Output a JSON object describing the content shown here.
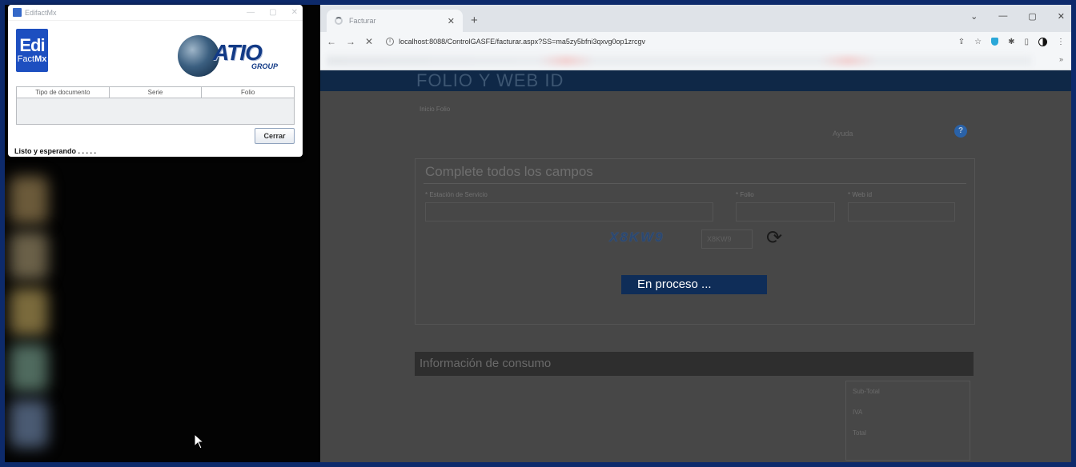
{
  "edi": {
    "title": "EdifactMx",
    "logo_top": "Edi",
    "logo_fact": "Fact",
    "logo_mx": "Mx",
    "atio_text": "ATIO",
    "atio_group": "GROUP",
    "columns": [
      "Tipo de documento",
      "Serie",
      "Folio"
    ],
    "close_button": "Cerrar",
    "status": "Listo y esperando . . . . ."
  },
  "browser": {
    "tab_title": "Facturar",
    "url": "localhost:8088/ControlGASFE/facturar.aspx?SS=ma5zy5bfni3qxvg0op1zrcgv",
    "more": "»"
  },
  "page": {
    "header": "FOLIO Y WEB ID",
    "crumbs": "Inicio    Folio",
    "ayuda": "Ayuda",
    "help_glyph": "?",
    "panel_title": "Complete todos los campos",
    "fields": {
      "estacion_label": "* Estación de Servicio",
      "estacion_value": "",
      "folio_label": "* Folio",
      "folio_value": "",
      "webid_label": "* Web id",
      "webid_value": ""
    },
    "captcha_text": "X8KW9",
    "captcha_input": "X8KW9",
    "processing": "En proceso ...",
    "consumo": "Información de consumo",
    "subtotal": "Sub-Total",
    "iva": "IVA",
    "total": "Total"
  }
}
